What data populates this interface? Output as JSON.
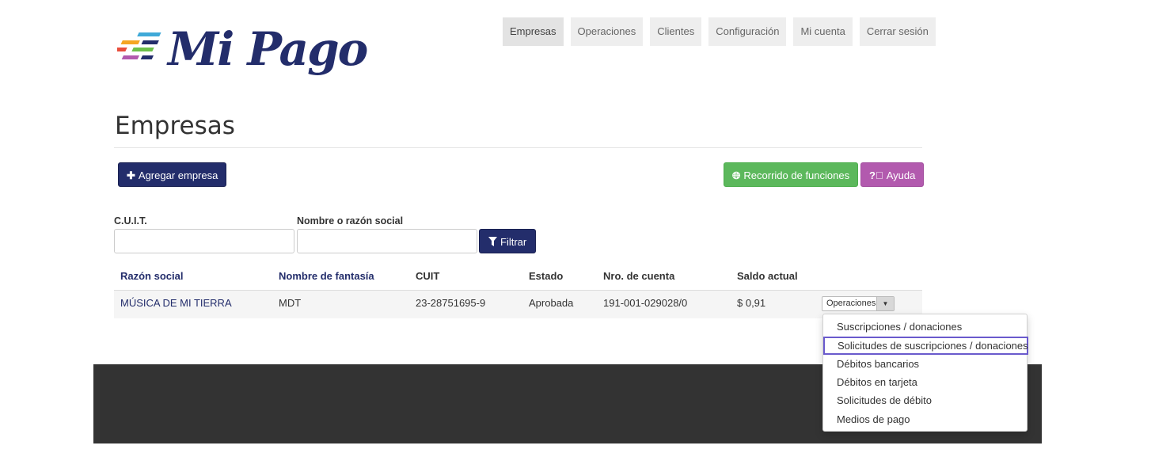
{
  "brand": {
    "name": "Mi Pago"
  },
  "nav": {
    "items": [
      {
        "label": "Empresas",
        "active": true
      },
      {
        "label": "Operaciones"
      },
      {
        "label": "Clientes"
      },
      {
        "label": "Configuración"
      },
      {
        "label": "Mi cuenta"
      },
      {
        "label": "Cerrar sesión"
      }
    ]
  },
  "page": {
    "title": "Empresas"
  },
  "toolbar": {
    "add_label": "Agregar empresa",
    "add_icon": "plus-icon",
    "tour_label": "Recorrido de funciones",
    "tour_icon": "globe-icon",
    "help_label": "Ayuda",
    "help_icon": "question-circle-icon"
  },
  "filters": {
    "cuit_label": "C.U.I.T.",
    "cuit_value": "",
    "name_label": "Nombre o razón social",
    "name_value": "",
    "filter_label": "Filtrar",
    "filter_icon": "funnel-icon"
  },
  "table": {
    "headers": [
      "Razón social",
      "Nombre de fantasía",
      "CUIT",
      "Estado",
      "Nro. de cuenta",
      "Saldo actual"
    ],
    "rows": [
      [
        "MÚSICA DE MI TIERRA",
        "MDT",
        "23-28751695-9",
        "Aprobada",
        "191-001-029028/0",
        "$ 0,91"
      ]
    ],
    "actions_label": "Operaciones"
  },
  "dropdown": {
    "items": [
      "Suscripciones / donaciones",
      "Solicitudes de suscripciones / donaciones",
      "Débitos bancarios",
      "Débitos en tarjeta",
      "Solicitudes de débito",
      "Medios de pago"
    ],
    "highlighted_index": 1,
    "highlight_color": "#6a5acd"
  },
  "colors": {
    "brand_navy": "#232d6b",
    "success": "#5cb85c",
    "help": "#b25aae",
    "footer": "#333333"
  }
}
